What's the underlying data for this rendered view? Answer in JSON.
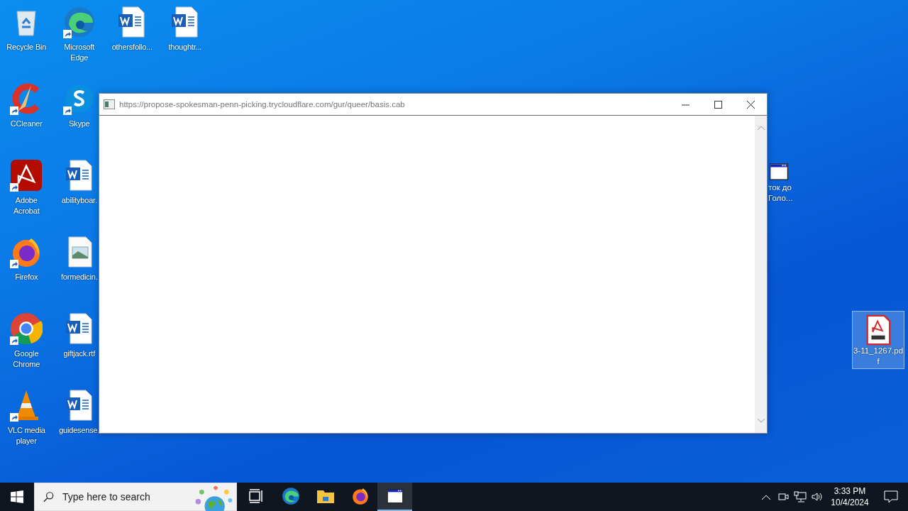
{
  "desktop": {
    "columns": [
      [
        {
          "kind": "recycle-bin",
          "label": "Recycle Bin",
          "shortcut": false,
          "selected": false
        },
        {
          "kind": "ccleaner",
          "label": "CCleaner",
          "shortcut": true,
          "selected": false
        },
        {
          "kind": "acrobat",
          "label": "Adobe Acrobat",
          "shortcut": true,
          "selected": false
        },
        {
          "kind": "firefox",
          "label": "Firefox",
          "shortcut": true,
          "selected": false
        },
        {
          "kind": "chrome",
          "label": "Google Chrome",
          "shortcut": true,
          "selected": false
        },
        {
          "kind": "vlc",
          "label": "VLC media player",
          "shortcut": true,
          "selected": false
        }
      ],
      [
        {
          "kind": "edge",
          "label": "Microsoft Edge",
          "shortcut": true,
          "selected": false
        },
        {
          "kind": "skype",
          "label": "Skype",
          "shortcut": true,
          "selected": false
        },
        {
          "kind": "word",
          "label": "abilityboar.",
          "shortcut": false,
          "selected": false
        },
        {
          "kind": "image",
          "label": "formedicin.",
          "shortcut": false,
          "selected": false
        },
        {
          "kind": "word",
          "label": "giftjack.rtf",
          "shortcut": false,
          "selected": false
        },
        {
          "kind": "word",
          "label": "guidesense.",
          "shortcut": false,
          "selected": false
        }
      ],
      [
        {
          "kind": "word",
          "label": "othersfollo...",
          "shortcut": false,
          "selected": false
        }
      ],
      [
        {
          "kind": "word",
          "label": "thoughtr...",
          "shortcut": false,
          "selected": false
        }
      ]
    ],
    "right_icons": [
      {
        "kind": "app-window",
        "lines": [
          "ток до",
          "Голо..."
        ],
        "selected": false
      },
      {
        "kind": "pdf",
        "lines": [
          "3-11_1267.pd",
          "f"
        ],
        "selected": true
      }
    ]
  },
  "window": {
    "title": "https://propose-spokesman-penn-picking.trycloudflare.com/gur/queer/basis.cab"
  },
  "taskbar": {
    "search": {
      "placeholder": "Type here to search"
    },
    "apps": [
      {
        "kind": "task-view",
        "selected": false
      },
      {
        "kind": "edge",
        "selected": false
      },
      {
        "kind": "explorer",
        "selected": false
      },
      {
        "kind": "firefox",
        "selected": false
      },
      {
        "kind": "app-window",
        "selected": true
      }
    ],
    "clock": {
      "time": "3:33 PM",
      "date": "10/4/2024"
    }
  }
}
